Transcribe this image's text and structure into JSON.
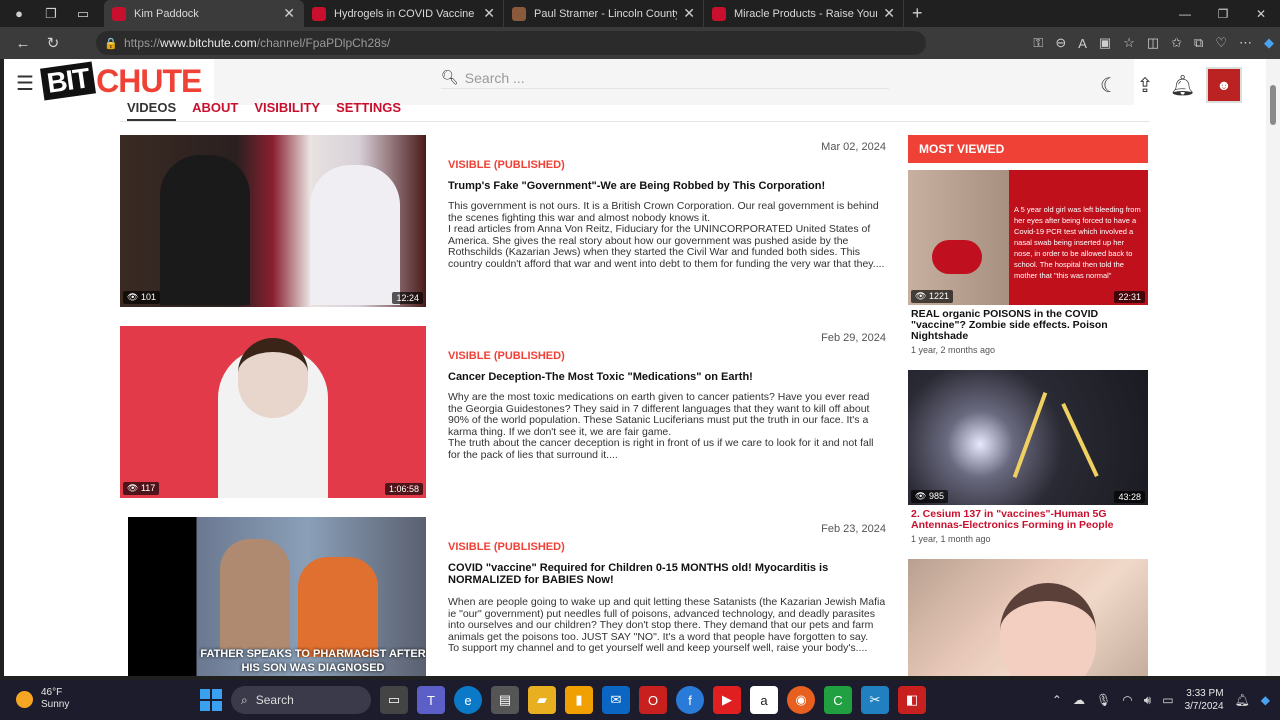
{
  "browser": {
    "tabs": [
      {
        "title": "Kim Paddock",
        "active": true,
        "favicon_color": "#c8102e"
      },
      {
        "title": "Hydrogels in COVID Vaccine as P",
        "active": false,
        "favicon_color": "#c8102e"
      },
      {
        "title": "Paul Stramer - Lincoln County W",
        "active": false,
        "favicon_color": "#8a5a3c"
      },
      {
        "title": "Miracle Products - Raise Your Bo",
        "active": false,
        "favicon_color": "#c8102e"
      }
    ],
    "url": {
      "protocol": "https://",
      "host": "www.bitchute.com",
      "path": "/channel/FpaPDlpCh28s/"
    }
  },
  "site": {
    "logo_bit": "BIT",
    "logo_chute": "CHUTE",
    "search_placeholder": "Search ...",
    "channel_tabs": [
      {
        "label": "VIDEOS",
        "active": true
      },
      {
        "label": "ABOUT",
        "active": false
      },
      {
        "label": "VISIBILITY",
        "active": false
      },
      {
        "label": "SETTINGS",
        "active": false
      }
    ]
  },
  "videos": [
    {
      "date": "Mar 02, 2024",
      "status": "VISIBLE (PUBLISHED)",
      "title": "Trump's Fake \"Government\"-We are Being Robbed by This Corporation!",
      "description": "This government is not ours. It is a British Crown Corporation. Our real government is behind the scenes fighting this war and almost nobody knows it.\nI read articles from Anna Von Reitz, Fiduciary for the UNINCORPORATED United States of America. She gives the real story about how our government was pushed aside by the Rothschilds (Kazarian Jews) when they started the Civil War and funded both sides. This country couldn't afford that war and went into debt to them for funding the very war that they....",
      "views": "101",
      "duration": "12:24",
      "thumb_caption": ""
    },
    {
      "date": "Feb 29, 2024",
      "status": "VISIBLE (PUBLISHED)",
      "title": "Cancer Deception-The Most Toxic \"Medications\" on Earth!",
      "description": "Why are the most toxic medications on earth given to cancer patients? Have you ever read the Georgia Guidestones? They said in 7 different languages that they want to kill off about 90% of the world population. These Satanic Luciferians must put the truth in our face. It's a karma thing. If we don't see it, we are fair game.\nThe truth about the cancer deception is right in front of us if we care to look for it and not fall for the pack of lies that surround it....",
      "views": "117",
      "duration": "1:06:58",
      "thumb_caption": ""
    },
    {
      "date": "Feb 23, 2024",
      "status": "VISIBLE (PUBLISHED)",
      "title": "COVID \"vaccine\" Required for Children 0-15 MONTHS old! Myocarditis is NORMALIZED for BABIES Now!",
      "description": "When are people going to wake up and quit letting these Satanists (the Kazarian Jewish Mafia ie \"our\" government) put needles full of poisons, advanced technology, and deadly parasites into ourselves and our children? They don't stop there. They demand that our pets and farm animals get the poisons too. JUST SAY \"NO\". It's a word that people have forgotten to say.\nTo support my channel and to get yourself well and keep yourself well, raise your body's....",
      "views": "",
      "duration": "",
      "thumb_caption": "FATHER SPEAKS TO PHARMACIST AFTER HIS SON WAS DIAGNOSED"
    }
  ],
  "sidebar": {
    "header": "MOST VIEWED",
    "items": [
      {
        "title": "REAL organic POISONS in the COVID \"vaccine\"? Zombie side effects. Poison Nightshade",
        "age": "1 year, 2 months ago",
        "views": "1221",
        "duration": "22:31",
        "overlay": "A 5 year old girl was left bleeding from her eyes after being forced to have a Covid-19 PCR test which involved a nasal swab being inserted up her nose, in order to be allowed back to school. The hospital then told the mother that \"this was normal\"",
        "title_red": false
      },
      {
        "title": "2. Cesium 137 in \"vaccines\"-Human 5G Antennas-Electronics Forming in People",
        "age": "1 year, 1 month ago",
        "views": "985",
        "duration": "43:28",
        "overlay": "",
        "title_red": true
      },
      {
        "title": "",
        "age": "",
        "views": "",
        "duration": "",
        "overlay": "",
        "title_red": false
      }
    ]
  },
  "taskbar": {
    "temp": "46°F",
    "condition": "Sunny",
    "search_label": "Search",
    "time": "3:33 PM",
    "date": "3/7/2024"
  },
  "colors": {
    "brand_red": "#ef4136",
    "link_red": "#c8102e"
  }
}
